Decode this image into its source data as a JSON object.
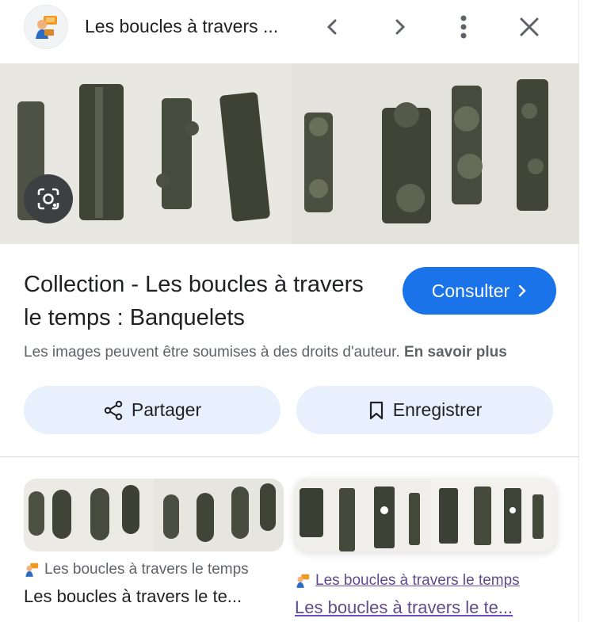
{
  "header": {
    "title": "Les boucles à travers ...",
    "prev_icon": "chevron-left-icon",
    "next_icon": "chevron-right-icon",
    "more_icon": "more-vert-icon",
    "close_icon": "close-icon"
  },
  "main": {
    "heading": "Collection - Les boucles à travers le temps : Banquelets",
    "visit_label": "Consulter",
    "rights_text": "Les images peuvent être soumises à des droits d'auteur.",
    "learn_more": "En savoir plus",
    "share_label": "Partager",
    "save_label": "Enregistrer"
  },
  "related": [
    {
      "source": "Les boucles à travers le temps",
      "title": "Les boucles à travers le te..."
    },
    {
      "source": "Les boucles à travers le temps",
      "title": "Les boucles à travers le te..."
    }
  ],
  "colors": {
    "accent": "#1a73e8",
    "pill": "#e8f0fe"
  }
}
